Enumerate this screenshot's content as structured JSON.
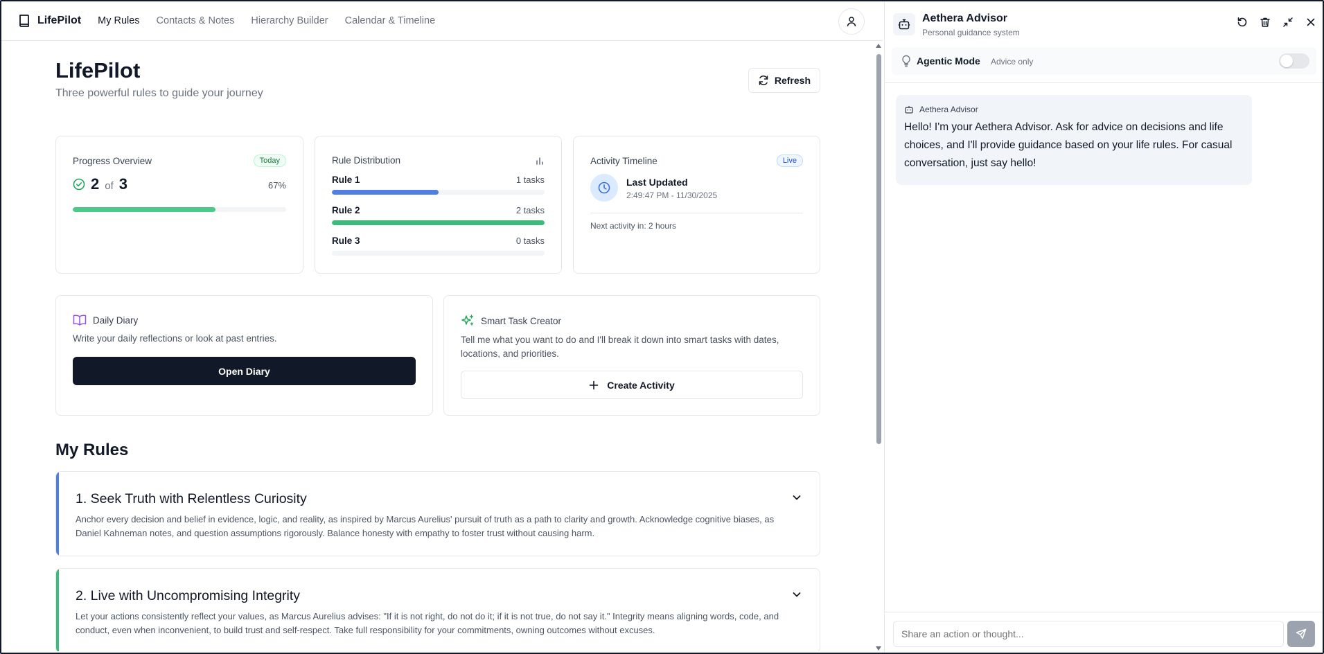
{
  "nav": {
    "brand": "LifePilot",
    "links": [
      "My Rules",
      "Contacts & Notes",
      "Hierarchy Builder",
      "Calendar & Timeline"
    ],
    "active": "My Rules"
  },
  "header": {
    "title": "LifePilot",
    "subtitle": "Three powerful rules to guide your journey",
    "refresh_label": "Refresh"
  },
  "progress": {
    "title": "Progress Overview",
    "badge": "Today",
    "done": "2",
    "of": "of",
    "total": "3",
    "percent_label": "67%",
    "fraction": 0.67
  },
  "distribution": {
    "title": "Rule Distribution",
    "rules": [
      {
        "label": "Rule 1",
        "count": "1 tasks",
        "fraction": 0.5,
        "color": "#4f7fe0"
      },
      {
        "label": "Rule 2",
        "count": "2 tasks",
        "fraction": 1.0,
        "color": "#3dba7c"
      },
      {
        "label": "Rule 3",
        "count": "0 tasks",
        "fraction": 0.0,
        "color": "#a855f7"
      }
    ]
  },
  "activity": {
    "title": "Activity Timeline",
    "badge": "Live",
    "last_updated_label": "Last Updated",
    "last_updated_value": "2:49:47 PM - 11/30/2025",
    "next": "Next activity in: 2 hours"
  },
  "diary": {
    "title": "Daily Diary",
    "desc": "Write your daily reflections or look at past entries.",
    "button": "Open Diary"
  },
  "task_creator": {
    "title": "Smart Task Creator",
    "desc": "Tell me what you want to do and I'll break it down into smart tasks with dates, locations, and priorities.",
    "button": "Create Activity"
  },
  "rules_section": {
    "title": "My Rules",
    "rules": [
      {
        "title": "1.  Seek Truth with Relentless Curiosity",
        "desc": "Anchor every decision and belief in evidence, logic, and reality, as inspired by Marcus Aurelius' pursuit of truth as a path to clarity and growth. Acknowledge cognitive biases, as Daniel Kahneman notes, and question assumptions rigorously. Balance honesty with empathy to foster trust without causing harm.",
        "color": "#4f7fe0"
      },
      {
        "title": "2.  Live with Uncompromising Integrity",
        "desc": "Let your actions consistently reflect your values, as Marcus Aurelius advises: \"If it is not right, do not do it; if it is not true, do not say it.\" Integrity means aligning words, code, and conduct, even when inconvenient, to build trust and self-respect. Take full responsibility for your commitments, owning outcomes without excuses.",
        "color": "#3dba7c"
      }
    ]
  },
  "advisor": {
    "title": "Aethera Advisor",
    "subtitle": "Personal guidance system",
    "agentic_label": "Agentic Mode",
    "agentic_sub": "Advice only",
    "message_author": "Aethera Advisor",
    "message": "Hello! I'm your Aethera Advisor. Ask for advice on decisions and life choices, and I'll provide guidance based on your life rules. For casual conversation, just say hello!",
    "input_placeholder": "Share an action or thought..."
  }
}
